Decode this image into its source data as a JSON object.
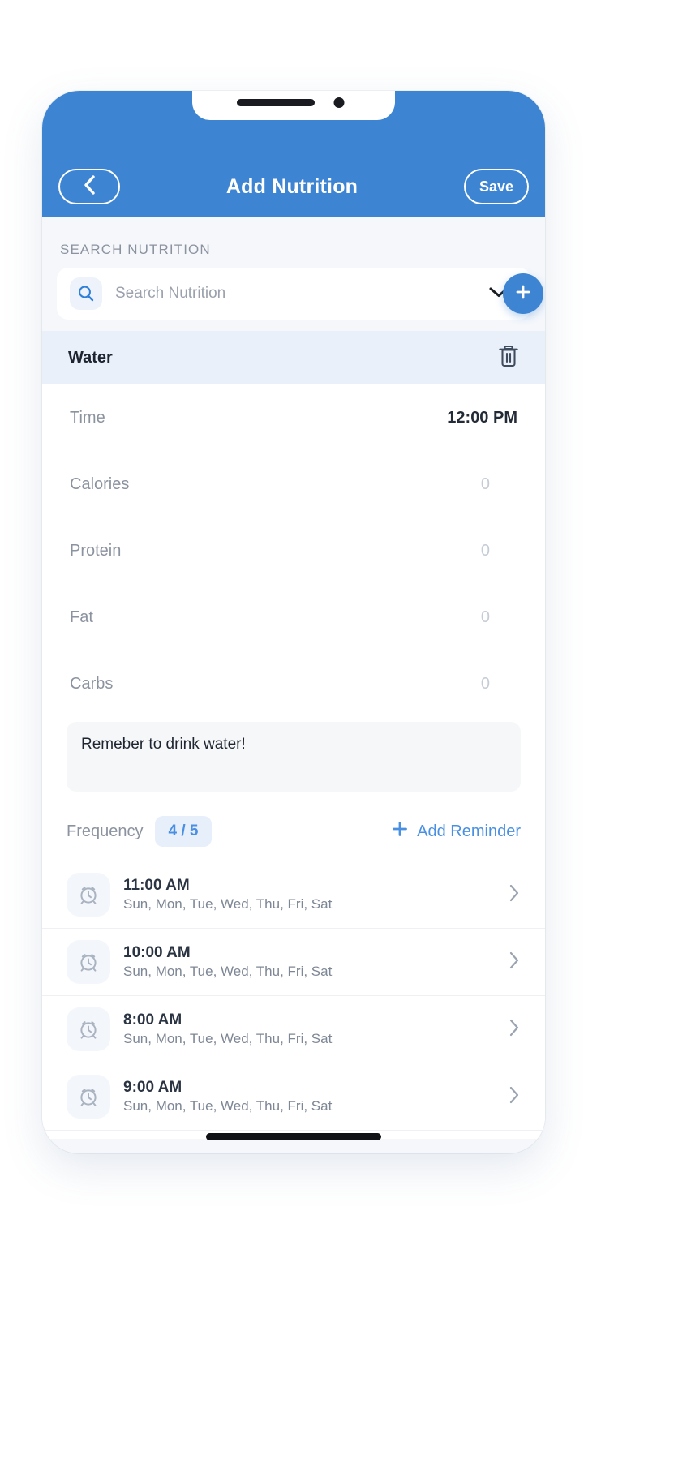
{
  "header": {
    "title": "Add Nutrition",
    "back_icon": "chevron-left-icon",
    "save_label": "Save",
    "background_color": "#3d85d3"
  },
  "search": {
    "section_label": "SEARCH NUTRITION",
    "placeholder": "Search Nutrition",
    "value": "",
    "search_icon": "search-icon",
    "dropdown_icon": "chevron-down-icon",
    "add_icon": "plus-icon"
  },
  "selected_item": {
    "name": "Water",
    "delete_icon": "trash-icon"
  },
  "fields": [
    {
      "label": "Time",
      "value": "12:00 PM",
      "is_placeholder": false
    },
    {
      "label": "Calories",
      "value": "0",
      "is_placeholder": true
    },
    {
      "label": "Protein",
      "value": "0",
      "is_placeholder": true
    },
    {
      "label": "Fat",
      "value": "0",
      "is_placeholder": true
    },
    {
      "label": "Carbs",
      "value": "0",
      "is_placeholder": true
    }
  ],
  "notes": {
    "value": "Remeber to drink water!"
  },
  "frequency": {
    "label": "Frequency",
    "badge": "4 / 5",
    "add_reminder_label": "Add Reminder",
    "add_icon": "plus-icon"
  },
  "reminders": [
    {
      "time": "11:00 AM",
      "days": "Sun, Mon, Tue, Wed, Thu, Fri, Sat",
      "icon": "alarm-clock-icon",
      "chevron": "chevron-right-icon"
    },
    {
      "time": "10:00 AM",
      "days": "Sun, Mon, Tue, Wed, Thu, Fri, Sat",
      "icon": "alarm-clock-icon",
      "chevron": "chevron-right-icon"
    },
    {
      "time": "8:00 AM",
      "days": "Sun, Mon, Tue, Wed, Thu, Fri, Sat",
      "icon": "alarm-clock-icon",
      "chevron": "chevron-right-icon"
    },
    {
      "time": "9:00 AM",
      "days": "Sun, Mon, Tue, Wed, Thu, Fri, Sat",
      "icon": "alarm-clock-icon",
      "chevron": "chevron-right-icon"
    }
  ],
  "colors": {
    "accent": "#3d85d3",
    "link": "#4a90e2",
    "page_background": "#f5f7fb",
    "selected_row": "#eaf0fa"
  }
}
